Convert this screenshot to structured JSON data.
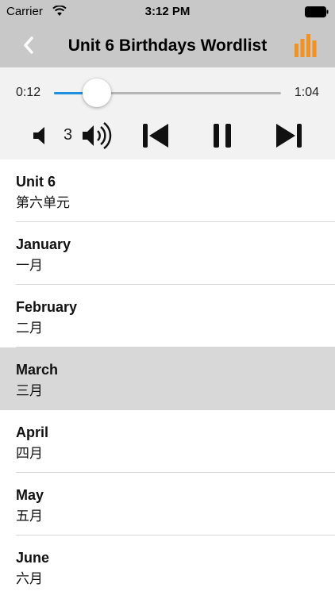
{
  "status_bar": {
    "carrier": "Carrier",
    "time": "3:12 PM"
  },
  "nav": {
    "title": "Unit 6 Birthdays Wordlist",
    "accent_color": "#f5911e"
  },
  "player": {
    "current_time": "0:12",
    "total_time": "1:04",
    "progress_fraction": 0.19,
    "volume_level": "3",
    "progress_color": "#1e90e0"
  },
  "words": [
    {
      "en": "Unit 6",
      "zh": "第六单元",
      "selected": false
    },
    {
      "en": "January",
      "zh": "一月",
      "selected": false
    },
    {
      "en": "February",
      "zh": "二月",
      "selected": false
    },
    {
      "en": "March",
      "zh": "三月",
      "selected": true
    },
    {
      "en": "April",
      "zh": "四月",
      "selected": false
    },
    {
      "en": "May",
      "zh": "五月",
      "selected": false
    },
    {
      "en": "June",
      "zh": "六月",
      "selected": false
    }
  ]
}
